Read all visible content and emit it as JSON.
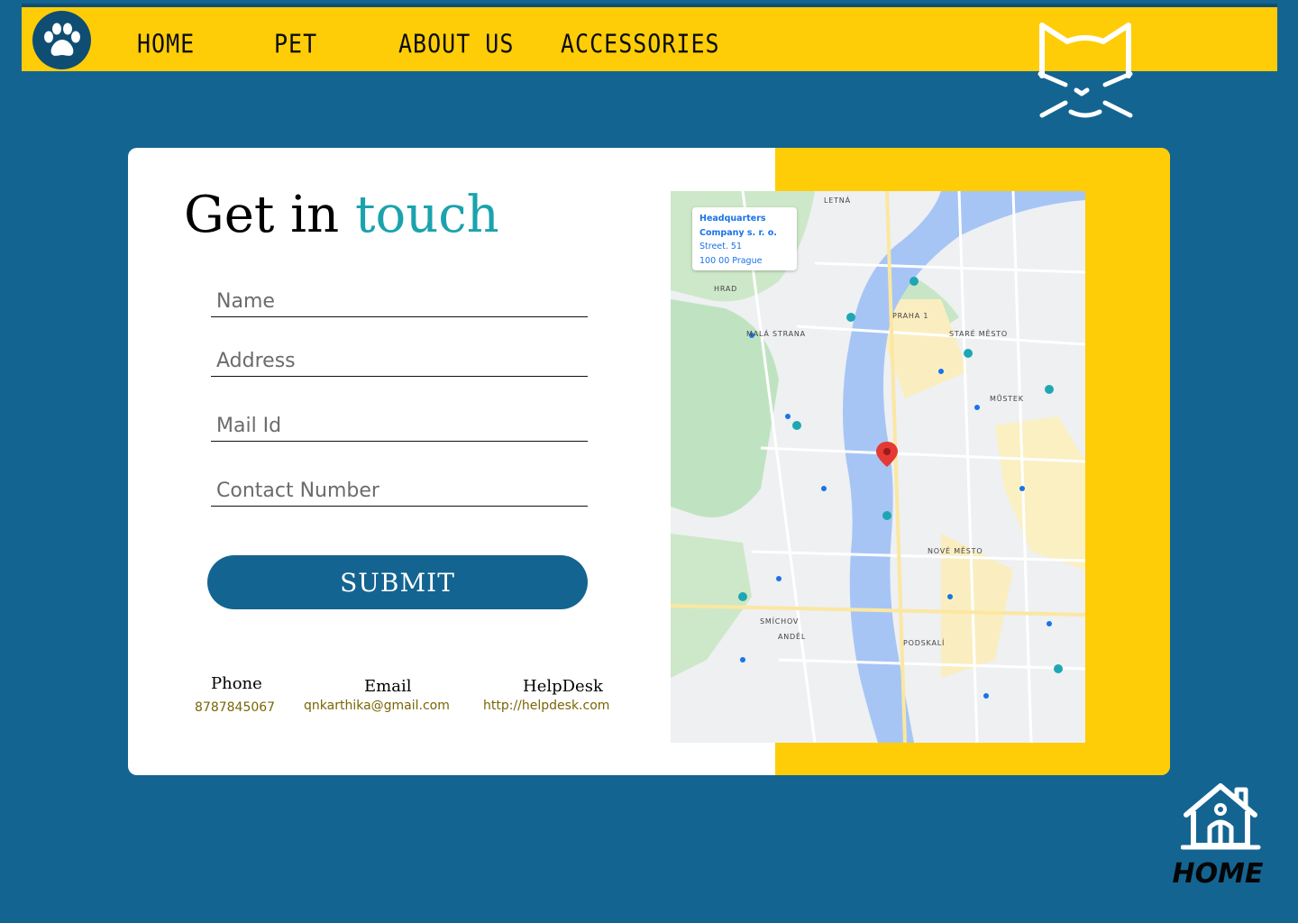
{
  "nav": {
    "items": [
      {
        "label": "HOME"
      },
      {
        "label": "PET"
      },
      {
        "label": "ABOUT US"
      },
      {
        "label": "ACCESSORIES"
      }
    ]
  },
  "contact": {
    "title_main": "Get in ",
    "title_accent": "touch",
    "form": {
      "name_placeholder": "Name",
      "address_placeholder": "Address",
      "mail_placeholder": "Mail Id",
      "phone_placeholder": "Contact Number",
      "submit_label": "SUBMIT"
    },
    "info": {
      "phone_label": "Phone",
      "phone_value": "8787845067",
      "email_label": "Email",
      "email_value": "qnkarthika@gmail.com",
      "helpdesk_label": "HelpDesk",
      "helpdesk_value": "http://helpdesk.com"
    }
  },
  "map": {
    "info_line1": "Headquarters",
    "info_line2": "Company s. r. o.",
    "info_line3": "Street. 51",
    "info_line4": "100 00 Prague",
    "labels": [
      "LETNÁ",
      "HRAD",
      "PRAHA 1",
      "MALÁ STRANA",
      "STARÉ MĚSTO",
      "MŮSTEK",
      "NOVÉ MĚSTO",
      "SMÍCHOV",
      "ANDĚL",
      "PODSKALÍ"
    ]
  },
  "home_widget": {
    "label": "HOME"
  },
  "colors": {
    "background": "#146491",
    "nav_bar": "#fecd07",
    "accent": "#1aa3ad",
    "button": "#146491"
  }
}
